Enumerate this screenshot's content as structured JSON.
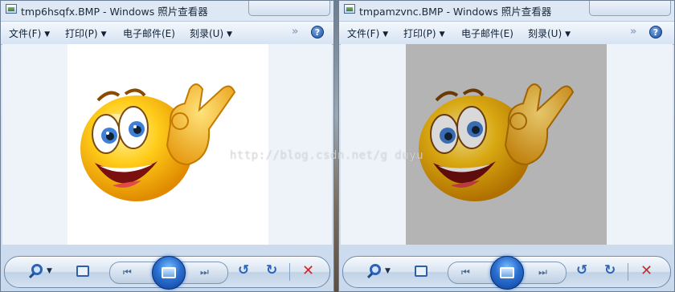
{
  "windows": [
    {
      "title": "tmp6hsqfx.BMP - Windows 照片查看器",
      "menu": [
        "文件(F)",
        "打印(P)",
        "电子邮件(E)",
        "刻录(U)"
      ],
      "image_background": "#ffffff"
    },
    {
      "title": "tmpamzvnc.BMP - Windows 照片查看器",
      "menu": [
        "文件(F)",
        "打印(P)",
        "电子邮件(E)",
        "刻录(U)"
      ],
      "image_background": "#b4b4b4"
    }
  ],
  "watermark": "http://blog.csdn.net/g     duyu",
  "icons": {
    "help": "?",
    "chevrons": "»",
    "menu_arrow": "▼",
    "prev": "⏮",
    "next": "⏭",
    "rotate_left": "↺",
    "rotate_right": "↻",
    "delete": "✕",
    "zoom_caret": "▼"
  }
}
